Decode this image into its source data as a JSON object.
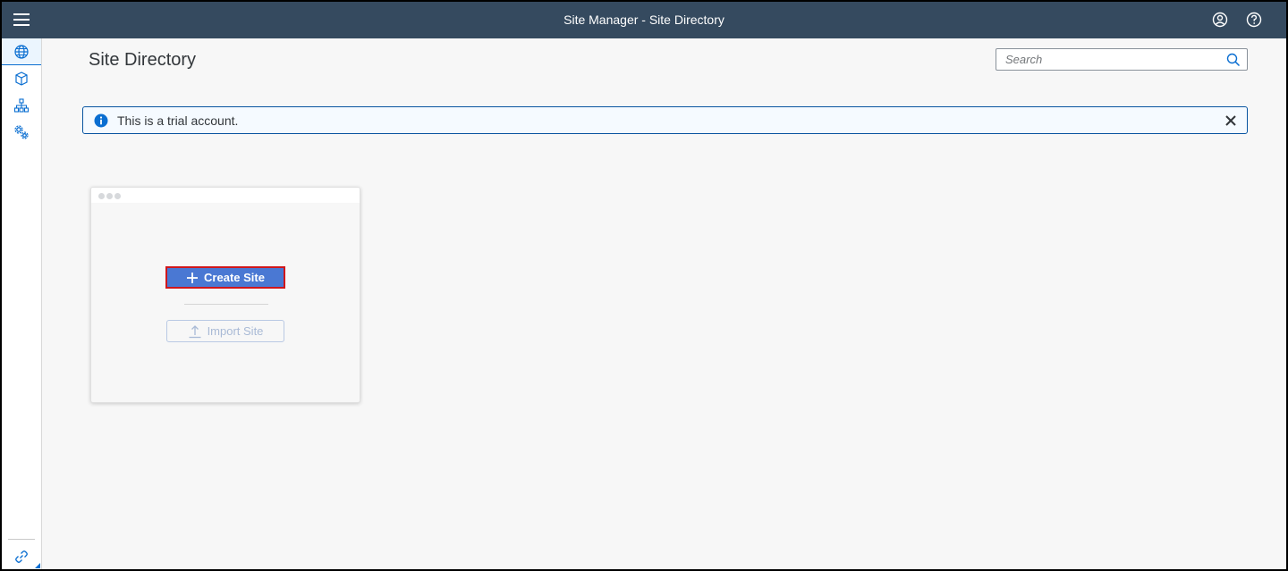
{
  "shell": {
    "title": "Site Manager - Site Directory"
  },
  "sidenav": {
    "items": [
      {
        "icon": "globe-icon",
        "active": true
      },
      {
        "icon": "cube-icon",
        "active": false
      },
      {
        "icon": "org-chart-icon",
        "active": false
      },
      {
        "icon": "settings-icon",
        "active": false
      }
    ],
    "footer_icon": "link-icon"
  },
  "main": {
    "page_title": "Site Directory",
    "search": {
      "placeholder": "Search",
      "value": ""
    },
    "message": {
      "text": "This is a trial account.",
      "type": "information"
    },
    "card": {
      "create_label": "Create Site",
      "import_label": "Import Site"
    }
  },
  "colors": {
    "shellbar": "#354a5f",
    "primary_button": "#4a78d3",
    "highlight_border": "#d0161b",
    "info_blue": "#0a6ed1"
  }
}
